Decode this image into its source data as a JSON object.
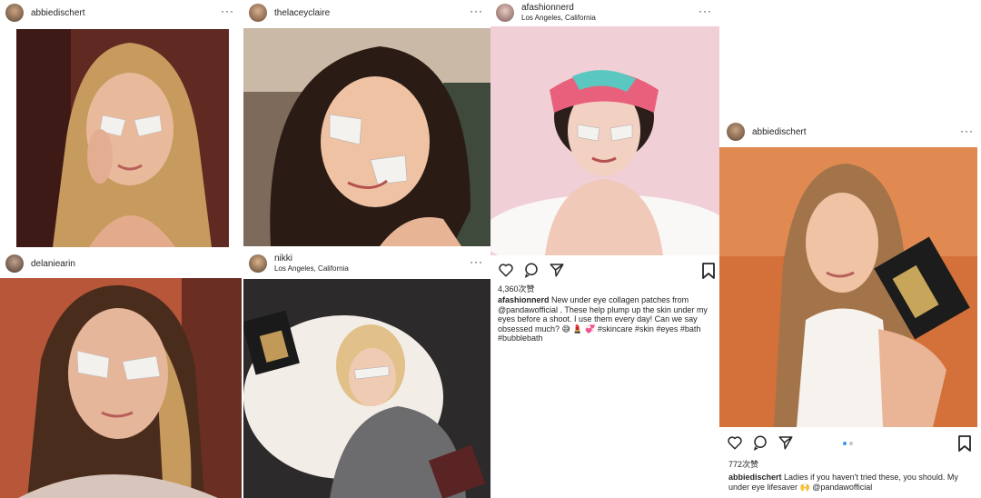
{
  "posts": [
    {
      "user": "abbiedischert",
      "location": ""
    },
    {
      "user": "thelaceyclaire",
      "location": ""
    },
    {
      "user": "afashionnerd",
      "location": "Los Angeles, California",
      "likes": "4,360次赞",
      "caption": {
        "user": "afashionnerd",
        "text": "New under eye collagen patches from @pandawofficial . These help plump up the skin under my eyes before a shoot. I use them every day! Can we say obsessed much? 😅 💄 💞 #skincare #skin #eyes #bath #bubblebath"
      }
    },
    {
      "user": "delaniearin",
      "location": ""
    },
    {
      "user": "nikki",
      "location": "Los Angeles, California"
    },
    {
      "user": "abbiedischert",
      "location": "",
      "likes": "772次赞",
      "caption": {
        "user": "abbiedischert",
        "text": "Ladies if you haven't tried these, you should. My under eye lifesaver 🙌 @pandawofficial"
      }
    }
  ],
  "menu_glyph": "···",
  "icons": [
    "heart-icon",
    "comment-icon",
    "share-icon",
    "bookmark-icon",
    "more-options-icon"
  ],
  "colors": {
    "link": "#003569",
    "carousel_active": "#3897f0"
  }
}
